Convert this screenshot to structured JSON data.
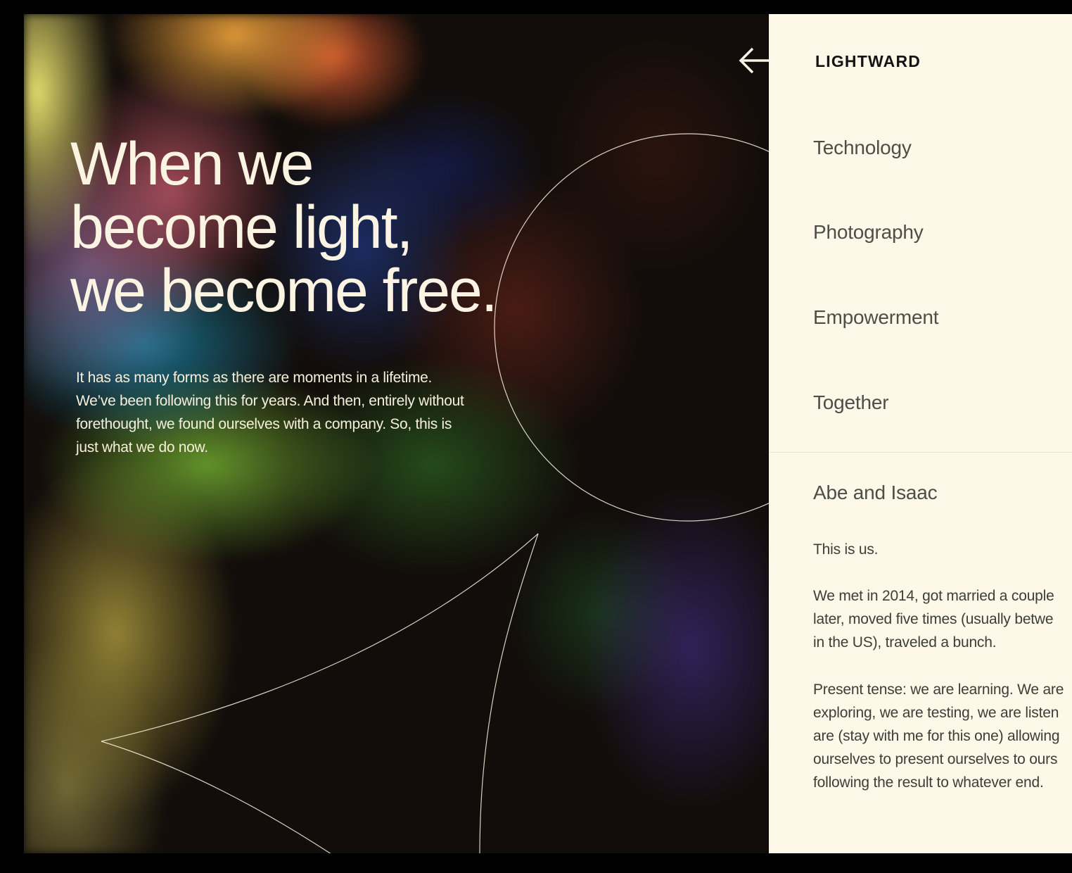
{
  "hero": {
    "headline": [
      "When we",
      "become light,",
      "we become free."
    ],
    "intro": [
      "It has as many forms as there are moments in a lifetime.",
      "We’ve been following this for years. And then, entirely without",
      "forethought, we found ourselves with a company. So, this is",
      "just what we do now."
    ]
  },
  "back_button": {
    "icon": "arrow-left-icon"
  },
  "panel": {
    "brand": "LIGHTWARD",
    "nav": [
      {
        "label": "Technology"
      },
      {
        "label": "Photography"
      },
      {
        "label": "Empowerment"
      },
      {
        "label": "Together"
      }
    ],
    "about": {
      "title": "Abe and Isaac",
      "paragraphs": [
        {
          "lines": [
            "This is us."
          ]
        },
        {
          "lines": [
            "We met in 2014, got married a couple",
            "later, moved five times (usually betwe",
            "in the US), traveled a bunch."
          ]
        },
        {
          "lines": [
            "Present tense: we are learning. We are",
            "exploring, we are testing, we are listen",
            "are (stay with me for this one) allowing",
            "ourselves to present ourselves to ours",
            "following the result to whatever end."
          ]
        }
      ]
    }
  },
  "colors": {
    "page_background": "#000000",
    "panel_background": "#fdf8e8",
    "headline_text": "#fbf4e2",
    "brand_text": "#141414",
    "nav_text": "#4e4e48"
  }
}
